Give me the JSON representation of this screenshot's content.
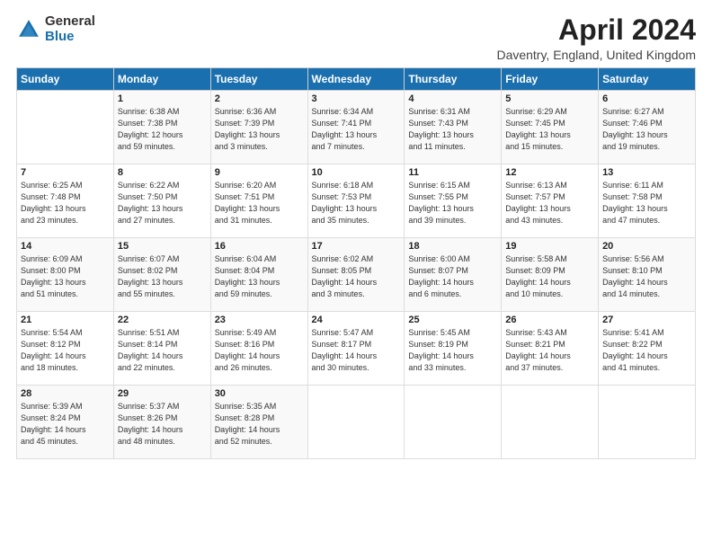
{
  "logo": {
    "general": "General",
    "blue": "Blue"
  },
  "title": "April 2024",
  "location": "Daventry, England, United Kingdom",
  "days_of_week": [
    "Sunday",
    "Monday",
    "Tuesday",
    "Wednesday",
    "Thursday",
    "Friday",
    "Saturday"
  ],
  "weeks": [
    [
      {
        "day": "",
        "info": ""
      },
      {
        "day": "1",
        "info": "Sunrise: 6:38 AM\nSunset: 7:38 PM\nDaylight: 12 hours\nand 59 minutes."
      },
      {
        "day": "2",
        "info": "Sunrise: 6:36 AM\nSunset: 7:39 PM\nDaylight: 13 hours\nand 3 minutes."
      },
      {
        "day": "3",
        "info": "Sunrise: 6:34 AM\nSunset: 7:41 PM\nDaylight: 13 hours\nand 7 minutes."
      },
      {
        "day": "4",
        "info": "Sunrise: 6:31 AM\nSunset: 7:43 PM\nDaylight: 13 hours\nand 11 minutes."
      },
      {
        "day": "5",
        "info": "Sunrise: 6:29 AM\nSunset: 7:45 PM\nDaylight: 13 hours\nand 15 minutes."
      },
      {
        "day": "6",
        "info": "Sunrise: 6:27 AM\nSunset: 7:46 PM\nDaylight: 13 hours\nand 19 minutes."
      }
    ],
    [
      {
        "day": "7",
        "info": "Sunrise: 6:25 AM\nSunset: 7:48 PM\nDaylight: 13 hours\nand 23 minutes."
      },
      {
        "day": "8",
        "info": "Sunrise: 6:22 AM\nSunset: 7:50 PM\nDaylight: 13 hours\nand 27 minutes."
      },
      {
        "day": "9",
        "info": "Sunrise: 6:20 AM\nSunset: 7:51 PM\nDaylight: 13 hours\nand 31 minutes."
      },
      {
        "day": "10",
        "info": "Sunrise: 6:18 AM\nSunset: 7:53 PM\nDaylight: 13 hours\nand 35 minutes."
      },
      {
        "day": "11",
        "info": "Sunrise: 6:15 AM\nSunset: 7:55 PM\nDaylight: 13 hours\nand 39 minutes."
      },
      {
        "day": "12",
        "info": "Sunrise: 6:13 AM\nSunset: 7:57 PM\nDaylight: 13 hours\nand 43 minutes."
      },
      {
        "day": "13",
        "info": "Sunrise: 6:11 AM\nSunset: 7:58 PM\nDaylight: 13 hours\nand 47 minutes."
      }
    ],
    [
      {
        "day": "14",
        "info": "Sunrise: 6:09 AM\nSunset: 8:00 PM\nDaylight: 13 hours\nand 51 minutes."
      },
      {
        "day": "15",
        "info": "Sunrise: 6:07 AM\nSunset: 8:02 PM\nDaylight: 13 hours\nand 55 minutes."
      },
      {
        "day": "16",
        "info": "Sunrise: 6:04 AM\nSunset: 8:04 PM\nDaylight: 13 hours\nand 59 minutes."
      },
      {
        "day": "17",
        "info": "Sunrise: 6:02 AM\nSunset: 8:05 PM\nDaylight: 14 hours\nand 3 minutes."
      },
      {
        "day": "18",
        "info": "Sunrise: 6:00 AM\nSunset: 8:07 PM\nDaylight: 14 hours\nand 6 minutes."
      },
      {
        "day": "19",
        "info": "Sunrise: 5:58 AM\nSunset: 8:09 PM\nDaylight: 14 hours\nand 10 minutes."
      },
      {
        "day": "20",
        "info": "Sunrise: 5:56 AM\nSunset: 8:10 PM\nDaylight: 14 hours\nand 14 minutes."
      }
    ],
    [
      {
        "day": "21",
        "info": "Sunrise: 5:54 AM\nSunset: 8:12 PM\nDaylight: 14 hours\nand 18 minutes."
      },
      {
        "day": "22",
        "info": "Sunrise: 5:51 AM\nSunset: 8:14 PM\nDaylight: 14 hours\nand 22 minutes."
      },
      {
        "day": "23",
        "info": "Sunrise: 5:49 AM\nSunset: 8:16 PM\nDaylight: 14 hours\nand 26 minutes."
      },
      {
        "day": "24",
        "info": "Sunrise: 5:47 AM\nSunset: 8:17 PM\nDaylight: 14 hours\nand 30 minutes."
      },
      {
        "day": "25",
        "info": "Sunrise: 5:45 AM\nSunset: 8:19 PM\nDaylight: 14 hours\nand 33 minutes."
      },
      {
        "day": "26",
        "info": "Sunrise: 5:43 AM\nSunset: 8:21 PM\nDaylight: 14 hours\nand 37 minutes."
      },
      {
        "day": "27",
        "info": "Sunrise: 5:41 AM\nSunset: 8:22 PM\nDaylight: 14 hours\nand 41 minutes."
      }
    ],
    [
      {
        "day": "28",
        "info": "Sunrise: 5:39 AM\nSunset: 8:24 PM\nDaylight: 14 hours\nand 45 minutes."
      },
      {
        "day": "29",
        "info": "Sunrise: 5:37 AM\nSunset: 8:26 PM\nDaylight: 14 hours\nand 48 minutes."
      },
      {
        "day": "30",
        "info": "Sunrise: 5:35 AM\nSunset: 8:28 PM\nDaylight: 14 hours\nand 52 minutes."
      },
      {
        "day": "",
        "info": ""
      },
      {
        "day": "",
        "info": ""
      },
      {
        "day": "",
        "info": ""
      },
      {
        "day": "",
        "info": ""
      }
    ]
  ]
}
